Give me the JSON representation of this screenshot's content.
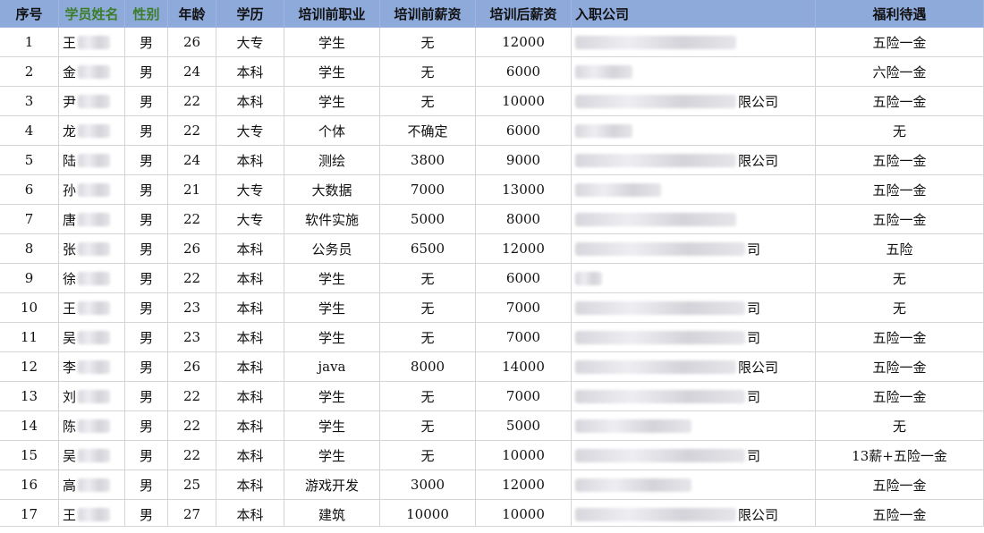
{
  "table": {
    "columns": [
      {
        "key": "no",
        "label": "序号"
      },
      {
        "key": "name",
        "label": "学员姓名"
      },
      {
        "key": "gender",
        "label": "性别"
      },
      {
        "key": "age",
        "label": "年龄"
      },
      {
        "key": "edu",
        "label": "学历"
      },
      {
        "key": "prev_job",
        "label": "培训前职业"
      },
      {
        "key": "prev_salary",
        "label": "培训前薪资"
      },
      {
        "key": "post_salary",
        "label": "培训后薪资"
      },
      {
        "key": "company",
        "label": "入职公司"
      },
      {
        "key": "benefit",
        "label": "福利待遇"
      }
    ],
    "rows": [
      {
        "no": "1",
        "name": "王",
        "gender": "男",
        "age": "26",
        "edu": "大专",
        "prev_job": "学生",
        "prev_salary": "无",
        "post_salary": "12000",
        "company": "",
        "benefit": "五险一金"
      },
      {
        "no": "2",
        "name": "金",
        "gender": "男",
        "age": "24",
        "edu": "本科",
        "prev_job": "学生",
        "prev_salary": "无",
        "post_salary": "6000",
        "company": "",
        "benefit": "六险一金"
      },
      {
        "no": "3",
        "name": "尹",
        "gender": "男",
        "age": "22",
        "edu": "本科",
        "prev_job": "学生",
        "prev_salary": "无",
        "post_salary": "10000",
        "company": "限公司",
        "benefit": "五险一金"
      },
      {
        "no": "4",
        "name": "龙",
        "gender": "男",
        "age": "22",
        "edu": "大专",
        "prev_job": "个体",
        "prev_salary": "不确定",
        "post_salary": "6000",
        "company": "",
        "benefit": "无"
      },
      {
        "no": "5",
        "name": "陆",
        "gender": "男",
        "age": "24",
        "edu": "本科",
        "prev_job": "测绘",
        "prev_salary": "3800",
        "post_salary": "9000",
        "company": "限公司",
        "benefit": "五险一金"
      },
      {
        "no": "6",
        "name": "孙",
        "gender": "男",
        "age": "21",
        "edu": "大专",
        "prev_job": "大数据",
        "prev_salary": "7000",
        "post_salary": "13000",
        "company": "",
        "benefit": "五险一金"
      },
      {
        "no": "7",
        "name": "唐",
        "gender": "男",
        "age": "22",
        "edu": "大专",
        "prev_job": "软件实施",
        "prev_salary": "5000",
        "post_salary": "8000",
        "company": "",
        "benefit": "五险一金"
      },
      {
        "no": "8",
        "name": "张",
        "gender": "男",
        "age": "26",
        "edu": "本科",
        "prev_job": "公务员",
        "prev_salary": "6500",
        "post_salary": "12000",
        "company": "司",
        "benefit": "五险"
      },
      {
        "no": "9",
        "name": "徐",
        "gender": "男",
        "age": "22",
        "edu": "本科",
        "prev_job": "学生",
        "prev_salary": "无",
        "post_salary": "6000",
        "company": "",
        "benefit": "无"
      },
      {
        "no": "10",
        "name": "王",
        "gender": "男",
        "age": "23",
        "edu": "本科",
        "prev_job": "学生",
        "prev_salary": "无",
        "post_salary": "7000",
        "company": "司",
        "benefit": "无"
      },
      {
        "no": "11",
        "name": "吴",
        "gender": "男",
        "age": "23",
        "edu": "本科",
        "prev_job": "学生",
        "prev_salary": "无",
        "post_salary": "7000",
        "company": "司",
        "benefit": "五险一金"
      },
      {
        "no": "12",
        "name": "李",
        "gender": "男",
        "age": "26",
        "edu": "本科",
        "prev_job": "java",
        "prev_salary": "8000",
        "post_salary": "14000",
        "company": "限公司",
        "benefit": "五险一金"
      },
      {
        "no": "13",
        "name": "刘",
        "gender": "男",
        "age": "22",
        "edu": "本科",
        "prev_job": "学生",
        "prev_salary": "无",
        "post_salary": "7000",
        "company": "司",
        "benefit": "五险一金"
      },
      {
        "no": "14",
        "name": "陈",
        "gender": "男",
        "age": "22",
        "edu": "本科",
        "prev_job": "学生",
        "prev_salary": "无",
        "post_salary": "5000",
        "company": "",
        "benefit": "无"
      },
      {
        "no": "15",
        "name": "吴",
        "gender": "男",
        "age": "22",
        "edu": "本科",
        "prev_job": "学生",
        "prev_salary": "无",
        "post_salary": "10000",
        "company": "司",
        "benefit": "13薪+五险一金"
      },
      {
        "no": "16",
        "name": "高",
        "gender": "男",
        "age": "25",
        "edu": "本科",
        "prev_job": "游戏开发",
        "prev_salary": "3000",
        "post_salary": "12000",
        "company": "",
        "benefit": "五险一金"
      },
      {
        "no": "17",
        "name": "王",
        "gender": "男",
        "age": "27",
        "edu": "本科",
        "prev_job": "建筑",
        "prev_salary": "10000",
        "post_salary": "10000",
        "company": "限公司",
        "benefit": "五险一金"
      }
    ]
  },
  "colors": {
    "header_bg": "#8eaadb",
    "header_text_alt": "#3d7d2a",
    "grid_line": "#d4d4d4"
  }
}
